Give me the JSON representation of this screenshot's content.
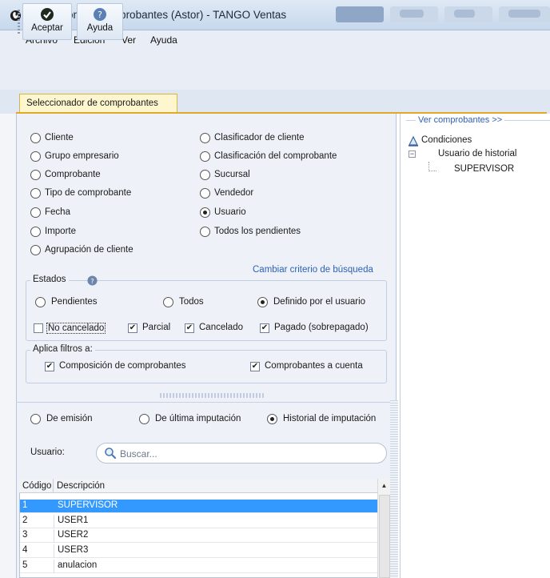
{
  "window": {
    "title": "Imputación de Comprobantes (Astor) - TANGO Ventas"
  },
  "menu": {
    "items": [
      "Archivo",
      "Edición",
      "Ver",
      "Ayuda"
    ]
  },
  "toolbar": {
    "accept_label": "Aceptar",
    "help_label": "Ayuda"
  },
  "tabs": {
    "selector_label": "Seleccionador de comprobantes"
  },
  "search_criteria": {
    "options_left": [
      "Cliente",
      "Grupo empresario",
      "Comprobante",
      "Tipo de comprobante",
      "Fecha",
      "Importe",
      "Agrupación de cliente"
    ],
    "options_right": [
      "Clasificador de cliente",
      "Clasificación del comprobante",
      "Sucursal",
      "Vendedor",
      "Usuario",
      "Todos los pendientes"
    ],
    "selected": "Usuario",
    "change_link": "Cambiar criterio de búsqueda"
  },
  "estados": {
    "title": "Estados",
    "radios": [
      "Pendientes",
      "Todos",
      "Definido por el usuario"
    ],
    "selected": "Definido por el usuario",
    "checks": [
      {
        "label": "No cancelado",
        "checked": false
      },
      {
        "label": "Parcial",
        "checked": true
      },
      {
        "label": "Cancelado",
        "checked": true
      },
      {
        "label": "Pagado (sobrepagado)",
        "checked": true
      }
    ]
  },
  "filtros": {
    "title": "Aplica filtros a:",
    "checks": [
      {
        "label": "Composición de comprobantes",
        "checked": true
      },
      {
        "label": "Comprobantes a cuenta",
        "checked": true
      }
    ]
  },
  "date_mode": {
    "options": [
      "De emisión",
      "De última imputación",
      "Historial de imputación"
    ],
    "selected": "Historial de imputación"
  },
  "user_search": {
    "label": "Usuario:",
    "placeholder": "Buscar..."
  },
  "grid": {
    "columns": [
      "Código",
      "Descripción"
    ],
    "rows": [
      {
        "code": "1",
        "desc": "SUPERVISOR",
        "selected": true
      },
      {
        "code": "2",
        "desc": "USER1",
        "selected": false
      },
      {
        "code": "3",
        "desc": "USER2",
        "selected": false
      },
      {
        "code": "4",
        "desc": "USER3",
        "selected": false
      },
      {
        "code": "5",
        "desc": "anulacion",
        "selected": false
      }
    ]
  },
  "right_panel": {
    "link": "Ver comprobantes >>",
    "root": "Condiciones",
    "child": "Usuario de historial",
    "leaf": "SUPERVISOR"
  },
  "colors": {
    "selection": "#3399ff",
    "link": "#2f5fb8",
    "tab_accent": "#e2a928"
  }
}
